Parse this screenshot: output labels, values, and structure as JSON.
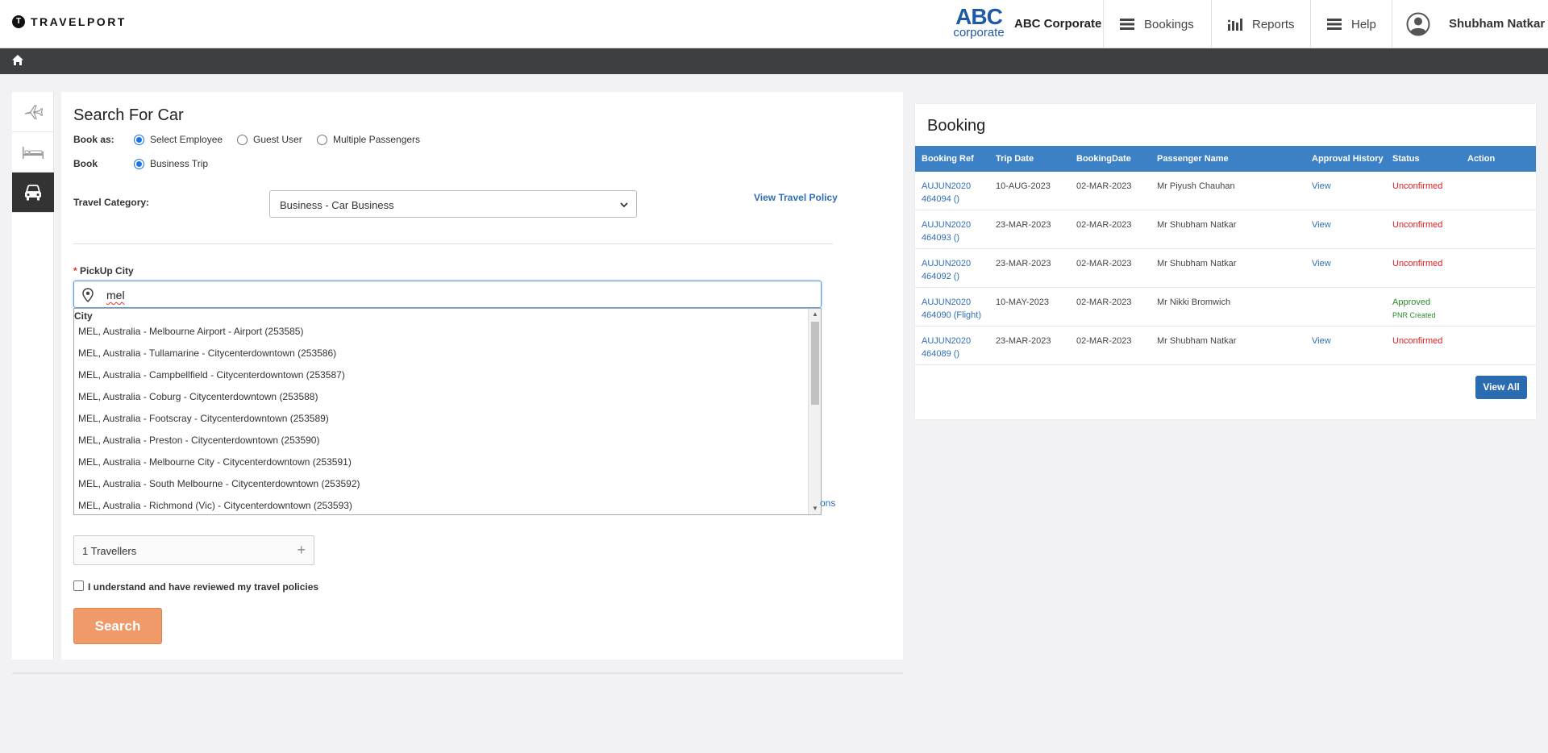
{
  "header": {
    "brand": "TRAVELPORT",
    "brand_mark": "T",
    "corp_logo_big": "ABC",
    "corp_logo_small": "corporate",
    "corp_name": "ABC Corporate",
    "nav": [
      {
        "label": "Bookings",
        "icon": "menu-icon"
      },
      {
        "label": "Reports",
        "icon": "bar-chart-icon"
      },
      {
        "label": "Help",
        "icon": "menu-icon"
      }
    ],
    "user_name": "Shubham Natkar"
  },
  "sidebar": {
    "tabs": [
      {
        "icon": "plane-icon",
        "active": false
      },
      {
        "icon": "bed-icon",
        "active": false
      },
      {
        "icon": "car-icon",
        "active": true
      }
    ]
  },
  "search": {
    "title": "Search For Car",
    "book_as_label": "Book as:",
    "book_as_options": [
      "Select Employee",
      "Guest User",
      "Multiple Passengers"
    ],
    "book_as_selected": "Select Employee",
    "book_label": "Book",
    "book_option": "Business Trip",
    "travel_category_label": "Travel Category:",
    "travel_category_value": "Business - Car Business",
    "view_policy": "View Travel Policy",
    "pickup_label": "PickUp City",
    "pickup_required": "*",
    "pickup_value": "mel",
    "dropdown_header": "City",
    "dropdown_items": [
      "MEL, Australia - Melbourne Airport - Airport (253585)",
      "MEL, Australia - Tullamarine - Citycenterdowntown (253586)",
      "MEL, Australia - Campbellfield - Citycenterdowntown (253587)",
      "MEL, Australia - Coburg - Citycenterdowntown (253588)",
      "MEL, Australia - Footscray - Citycenterdowntown (253589)",
      "MEL, Australia - Preston - Citycenterdowntown (253590)",
      "MEL, Australia - Melbourne City - Citycenterdowntown (253591)",
      "MEL, Australia - South Melbourne - Citycenterdowntown (253592)",
      "MEL, Australia - Richmond (Vic) - Citycenterdowntown (253593)"
    ],
    "partial_link": "ons",
    "travellers": "1 Travellers",
    "policy_check": "I understand and have reviewed my travel policies",
    "search_button": "Search"
  },
  "booking": {
    "title": "Booking",
    "columns": [
      "Booking Ref",
      "Trip Date",
      "BookingDate",
      "Passenger Name",
      "Approval History",
      "Status",
      "Action"
    ],
    "rows": [
      {
        "ref1": "AUJUN2020",
        "ref2": "464094 ()",
        "trip": "10-AUG-2023",
        "booked": "02-MAR-2023",
        "passenger": "Mr Piyush Chauhan",
        "approval": "View",
        "status": "Unconfirmed",
        "sub": ""
      },
      {
        "ref1": "AUJUN2020",
        "ref2": "464093 ()",
        "trip": "23-MAR-2023",
        "booked": "02-MAR-2023",
        "passenger": "Mr Shubham Natkar",
        "approval": "View",
        "status": "Unconfirmed",
        "sub": ""
      },
      {
        "ref1": "AUJUN2020",
        "ref2": "464092 ()",
        "trip": "23-MAR-2023",
        "booked": "02-MAR-2023",
        "passenger": "Mr Shubham Natkar",
        "approval": "View",
        "status": "Unconfirmed",
        "sub": ""
      },
      {
        "ref1": "AUJUN2020",
        "ref2": "464090 (Flight)",
        "trip": "10-MAY-2023",
        "booked": "02-MAR-2023",
        "passenger": "Mr Nikki Bromwich",
        "approval": "",
        "status": "Approved",
        "sub": "PNR Created"
      },
      {
        "ref1": "AUJUN2020",
        "ref2": "464089 ()",
        "trip": "23-MAR-2023",
        "booked": "02-MAR-2023",
        "passenger": "Mr Shubham Natkar",
        "approval": "View",
        "status": "Unconfirmed",
        "sub": ""
      }
    ],
    "view_all": "View All"
  },
  "colors": {
    "accent_blue": "#3c80c6",
    "link_blue": "#2f6fb5",
    "search_orange": "#ef9a68",
    "unconfirmed_red": "#e02020",
    "approved_green": "#2b8a2b",
    "dark_bar": "#3d4043"
  }
}
